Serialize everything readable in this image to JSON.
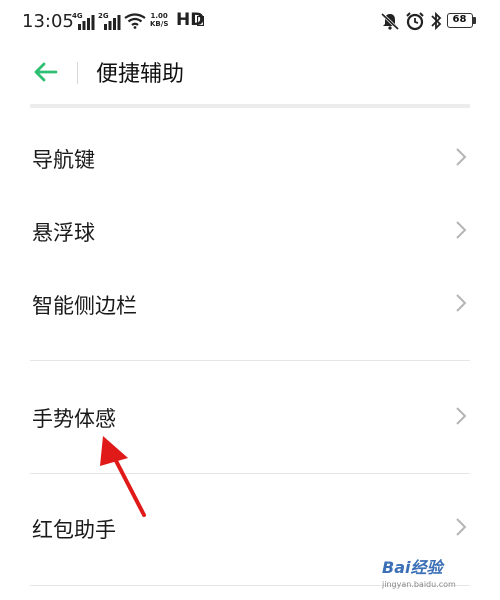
{
  "status_bar": {
    "time": "13:05",
    "sim1_network": "4G",
    "sim2_network": "2G",
    "speed_value": "1.00",
    "speed_unit": "KB/S",
    "hd_label": "HD",
    "battery_level": "68",
    "icons": [
      "signal-icon",
      "wifi-icon",
      "mute-icon",
      "alarm-icon",
      "bluetooth-icon",
      "battery-icon"
    ]
  },
  "header": {
    "back_icon": "back-arrow-icon",
    "title": "便捷辅助",
    "accent_color": "#2fbf71"
  },
  "menu": {
    "items": [
      {
        "label": "导航键"
      },
      {
        "label": "悬浮球"
      },
      {
        "label": "智能侧边栏"
      },
      {
        "label": "手势体感"
      },
      {
        "label": "红包助手"
      }
    ]
  },
  "annotation": {
    "arrow_color": "#e01919"
  },
  "watermark": {
    "text": "Bai经验",
    "url": "jingyan.baidu.com"
  }
}
